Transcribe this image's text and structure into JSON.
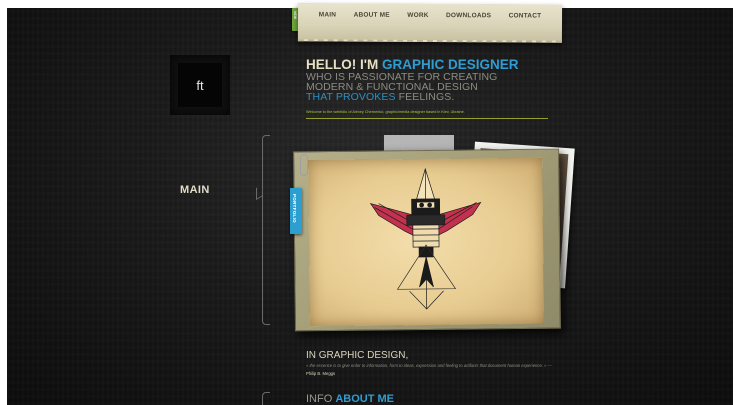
{
  "nav": {
    "tab_label": "NEW",
    "items": [
      "MAIN",
      "ABOUT ME",
      "WORK",
      "DOWNLOADS",
      "CONTACT"
    ]
  },
  "logo": {
    "text": "ft"
  },
  "hero": {
    "hello": "HELLO! I'M ",
    "role": "GRAPHIC DESIGNER",
    "line2": "WHO IS PASSIONATE FOR CREATING",
    "line3": "MODERN & FUNCTIONAL DESIGN",
    "line4_blue": "THAT PROVOKES",
    "line4_rest": " FEELINGS.",
    "welcome": "Welcome to the webfolio of Alexey Chernenko, graphic/media designer based in Kiev, Ukraine."
  },
  "section": {
    "main_label": "MAIN"
  },
  "portfolio": {
    "tab_label": "PORTFOLIO"
  },
  "quote": {
    "title": "IN GRAPHIC DESIGN,",
    "text": "» the essence is to give order to information, form to ideas, expression and feeling to artifacts that document human experience. » —",
    "author": "Philip B. Meggs"
  },
  "info": {
    "prefix": "INFO ",
    "highlight": "ABOUT ME"
  },
  "colors": {
    "accent_blue": "#2f9dd1",
    "accent_green": "#a9c935",
    "background": "#1a1a1a",
    "illustration_red": "#c2324f"
  }
}
